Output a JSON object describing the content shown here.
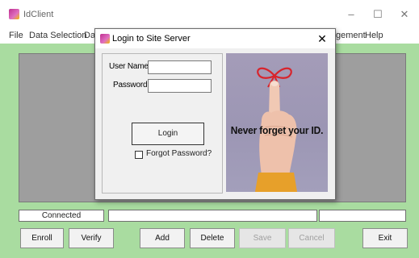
{
  "window": {
    "title": "IdClient",
    "minimize_glyph": "–",
    "maximize_glyph": "☐",
    "close_glyph": "✕"
  },
  "menu": [
    {
      "label": "File"
    },
    {
      "label": "Data Selection"
    },
    {
      "label": "Da"
    },
    {
      "label": "gement"
    },
    {
      "label": "Help"
    }
  ],
  "status": {
    "connection": "Connected",
    "middle": "",
    "right": ""
  },
  "buttons": {
    "enroll": "Enroll",
    "verify": "Verify",
    "add": "Add",
    "delete": "Delete",
    "save": "Save",
    "cancel": "Cancel",
    "exit": "Exit"
  },
  "dialog": {
    "title": "Login to Site Server",
    "close_glyph": "✕",
    "username_label": "User Name:",
    "username_value": "",
    "password_label": "Password:",
    "password_value": "",
    "login_button": "Login",
    "forgot_label": "Forgot Password?",
    "forgot_checked": false,
    "ad_text": "Never forget your ID."
  },
  "colors": {
    "client_bg": "#a9dca0",
    "panel_bg": "#9e9e9e",
    "ad_bg": "#a49cb8",
    "ribbon": "#d8242c"
  },
  "icons": [
    "app-icon",
    "dialog-app-icon",
    "finger-with-ribbon-illustration"
  ]
}
